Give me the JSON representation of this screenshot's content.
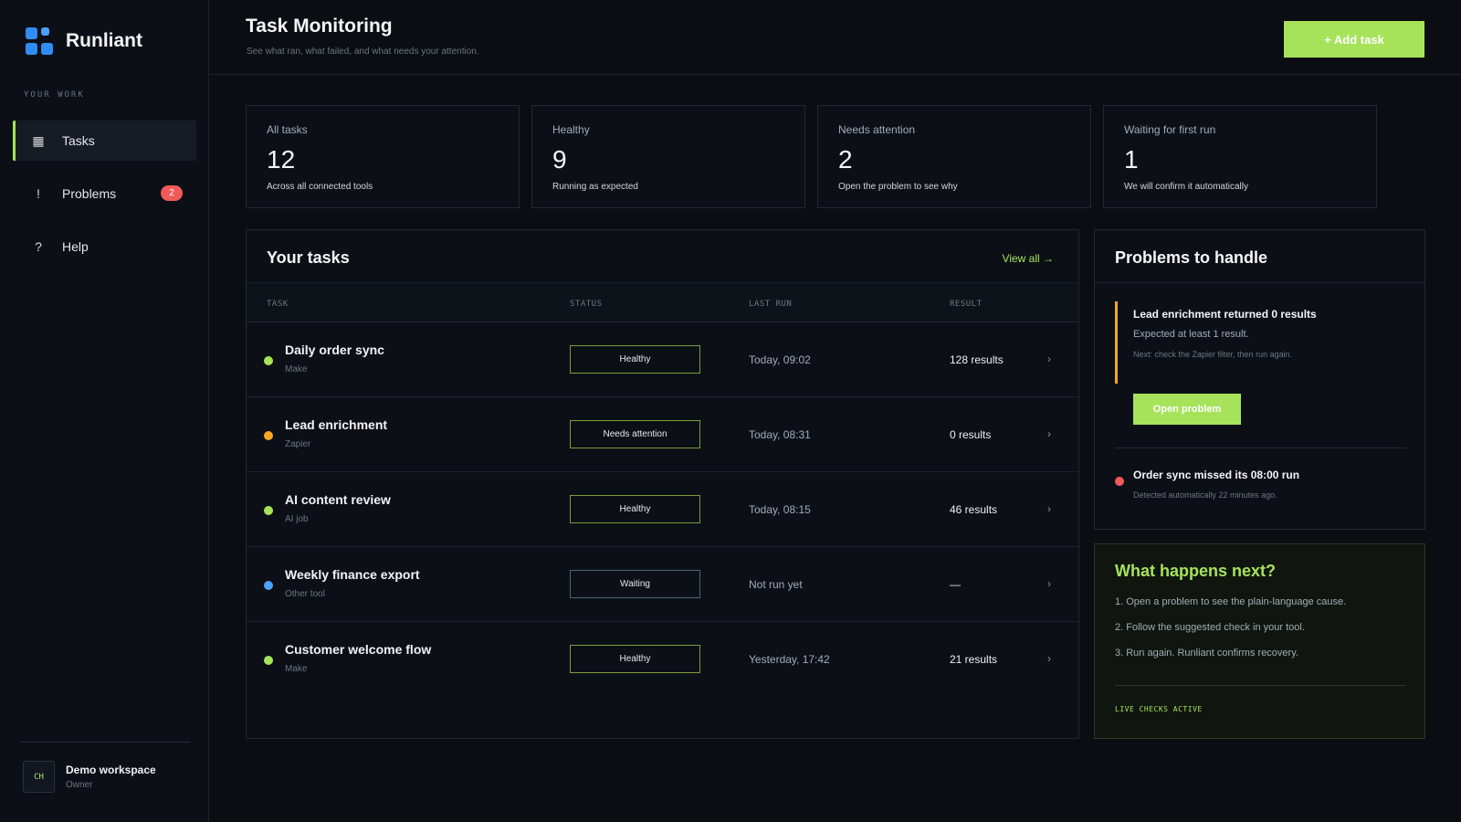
{
  "app": {
    "name": "Runliant"
  },
  "sidebar": {
    "section_label": "YOUR WORK",
    "items": [
      {
        "label": "Tasks",
        "icon": "grid-icon",
        "glyph": "▦",
        "active": true
      },
      {
        "label": "Problems",
        "icon": "exclamation-icon",
        "glyph": "!",
        "badge": "2"
      },
      {
        "label": "Help",
        "icon": "question-icon",
        "glyph": "?"
      }
    ],
    "workspace": {
      "initials": "CH",
      "name": "Demo workspace",
      "role": "Owner"
    }
  },
  "header": {
    "title": "Task Monitoring",
    "subtitle": "See what ran, what failed, and what needs your attention.",
    "add_button": "+ Add task"
  },
  "stats": [
    {
      "label": "All tasks",
      "value": "12",
      "note": "Across all connected tools"
    },
    {
      "label": "Healthy",
      "value": "9",
      "note": "Running as expected"
    },
    {
      "label": "Needs attention",
      "value": "2",
      "note": "Open the problem to see why"
    },
    {
      "label": "Waiting for first run",
      "value": "1",
      "note": "We will confirm it automatically"
    }
  ],
  "tasks": {
    "title": "Your tasks",
    "view_all": "View all →",
    "columns": [
      "TASK",
      "STATUS",
      "LAST RUN",
      "RESULT"
    ],
    "rows": [
      {
        "name": "Daily order sync",
        "tool": "Make",
        "status": "Healthy",
        "last_run": "Today, 09:02",
        "result": "128 results",
        "dot_color": "#a6e35a"
      },
      {
        "name": "Lead enrichment",
        "tool": "Zapier",
        "status": "Needs attention",
        "last_run": "Today, 08:31",
        "result": "0 results",
        "dot_color": "#f5a623"
      },
      {
        "name": "AI content review",
        "tool": "AI job",
        "status": "Healthy",
        "last_run": "Today, 08:15",
        "result": "46 results",
        "dot_color": "#a6e35a"
      },
      {
        "name": "Weekly finance export",
        "tool": "Other tool",
        "status": "Waiting",
        "last_run": "Not run yet",
        "result": "—",
        "dot_color": "#4aa3ff"
      },
      {
        "name": "Customer welcome flow",
        "tool": "Make",
        "status": "Healthy",
        "last_run": "Yesterday, 17:42",
        "result": "21 results",
        "dot_color": "#a6e35a"
      }
    ],
    "chevron": "›"
  },
  "problems": {
    "title": "Problems to handle",
    "first": {
      "title": "Lead enrichment returned 0 results",
      "desc": "Expected at least 1 result.",
      "next": "Next: check the Zapier filter, then run again.",
      "button": "Open problem"
    },
    "second": {
      "title": "Order sync missed its 08:00 run",
      "desc": "Detected automatically 22 minutes ago."
    }
  },
  "next_steps": {
    "title": "What happens next?",
    "items": [
      "1. Open a problem to see the plain-language cause.",
      "2. Follow the suggested check in your tool.",
      "3. Run again. Runliant confirms recovery."
    ],
    "status": "LIVE CHECKS ACTIVE"
  },
  "colors": {
    "accent": "#a6e35a",
    "warning": "#f5a623",
    "danger": "#f25a5a",
    "info": "#4aa3ff",
    "background": "#0a0d12"
  }
}
